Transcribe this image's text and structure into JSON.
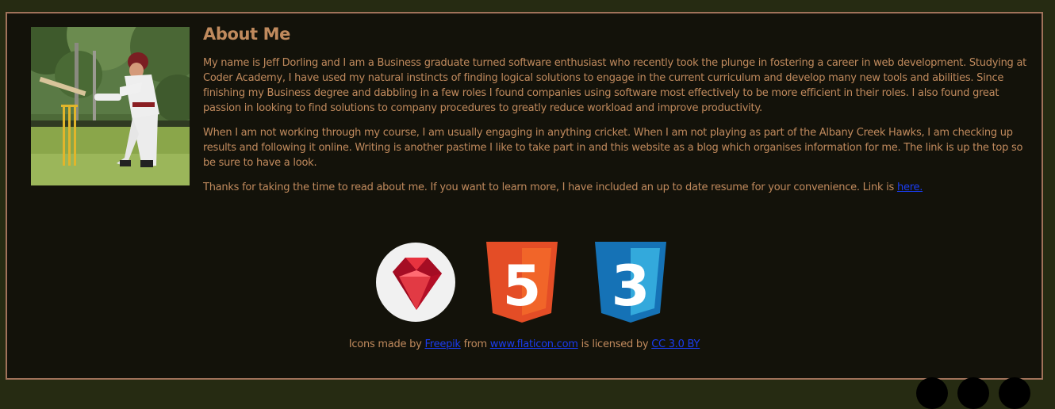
{
  "about": {
    "title": "About Me",
    "paragraphs": [
      "My name is Jeff Dorling and I am a Business graduate turned software enthusiast who recently took the plunge in fostering a career in web development. Studying at Coder Academy, I have used my natural instincts of finding logical solutions to engage in the current curriculum and develop many new tools and abilities. Since finishing my Business degree and dabbling in a few roles I found companies using software most effectively to be more efficient in their roles. I also found great passion in looking to find solutions to company procedures to greatly reduce workload and improve productivity.",
      "When I am not working through my course, I am usually engaging in anything cricket. When I am not playing as part of the Albany Creek Hawks, I am checking up results and following it online. Writing is another pastime I like to take part in and this website as a blog which organises information for me. The link is up the top so be sure to have a look."
    ],
    "resume_text": "Thanks for taking the time to read about me. If you want to learn more, I have included an up to date resume for your convenience. Link is ",
    "resume_link": "here."
  },
  "icons": [
    "ruby-icon",
    "html5-icon",
    "css3-icon"
  ],
  "html5_number": "5",
  "css3_number": "3",
  "credits": {
    "prefix": "Icons made by ",
    "author": "Freepik",
    "from": " from ",
    "site": "www.flaticon.com",
    "license_text": " is licensed by ",
    "license": "CC 3.0 BY"
  },
  "colors": {
    "background": "#262b12",
    "panel": "#13120a",
    "border": "#a0725a",
    "text": "#c08a5d",
    "link": "#1a3cf0"
  }
}
